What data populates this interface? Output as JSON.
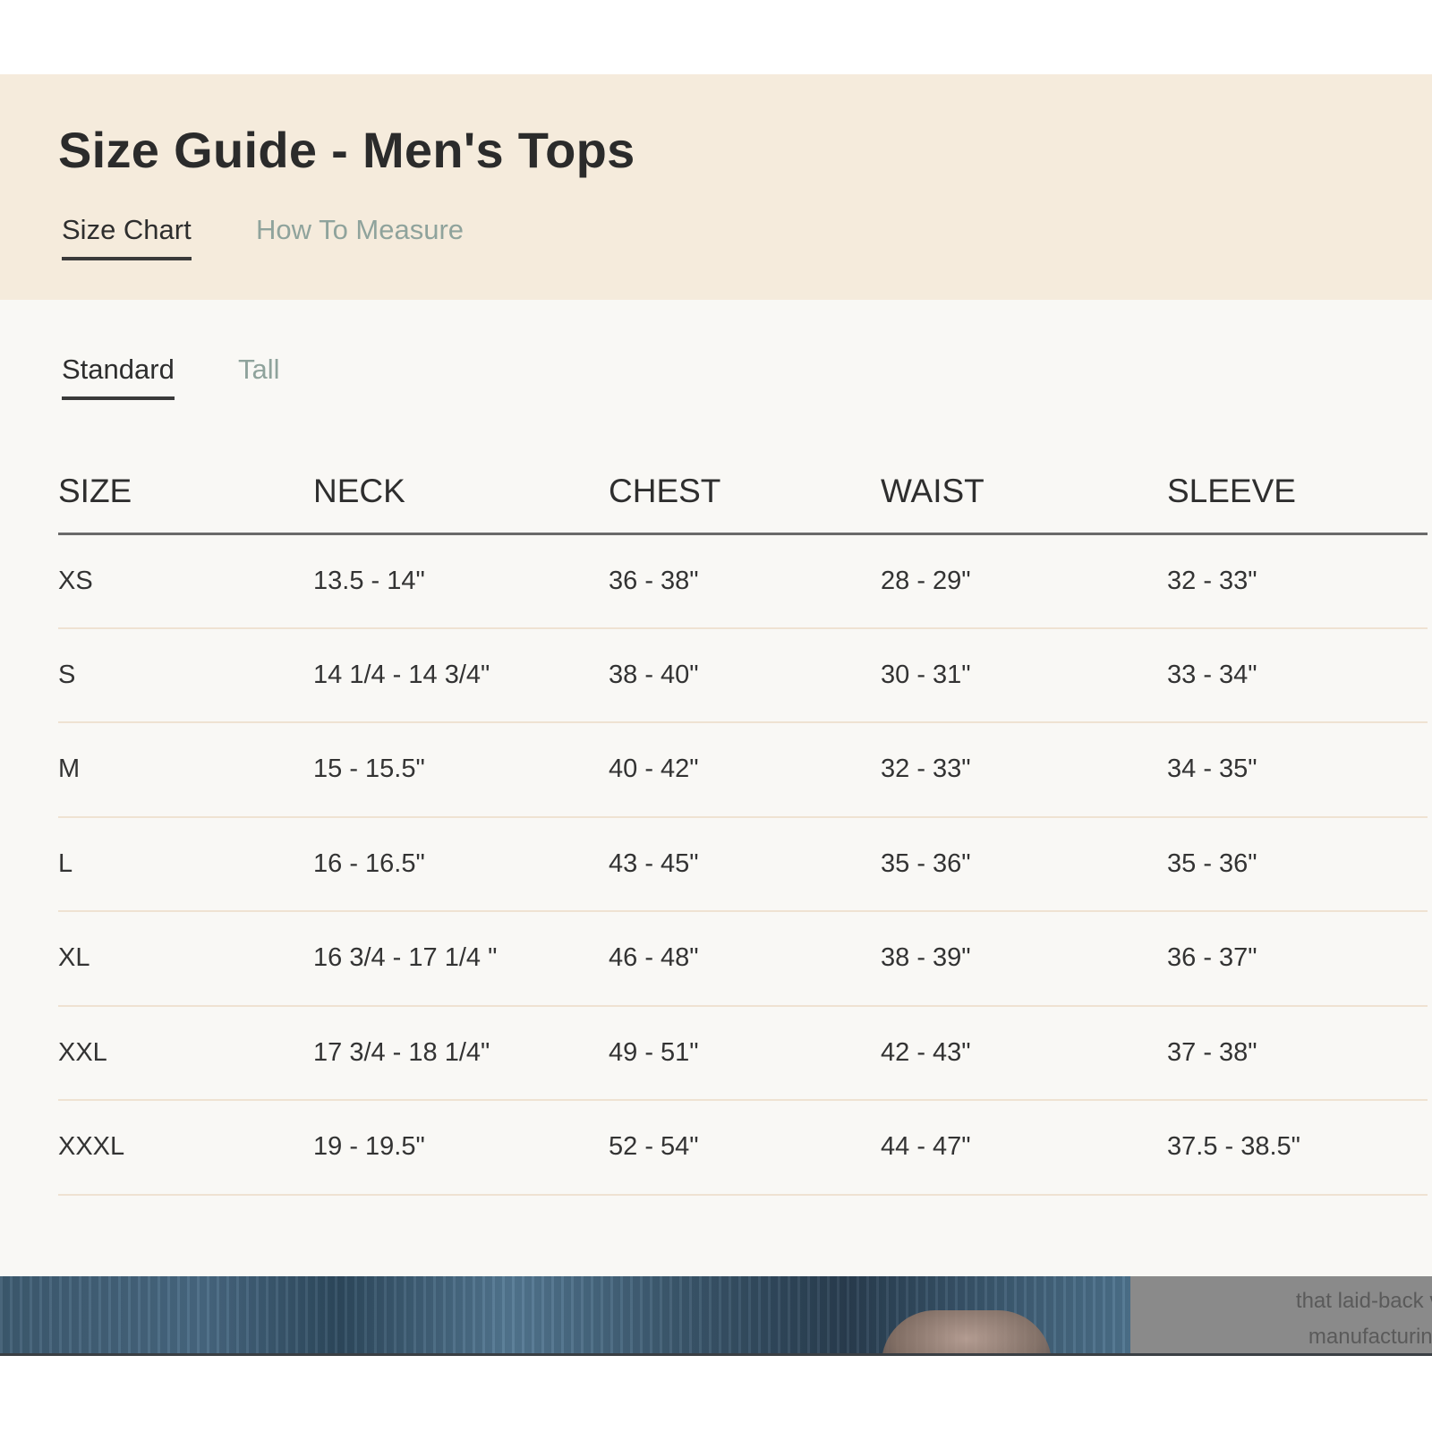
{
  "header": {
    "title": "Size Guide - Men's Tops",
    "tabs": [
      {
        "label": "Size Chart",
        "active": true
      },
      {
        "label": "How To Measure",
        "active": false
      }
    ]
  },
  "fit_tabs": [
    {
      "label": "Standard",
      "active": true
    },
    {
      "label": "Tall",
      "active": false
    }
  ],
  "table": {
    "headers": [
      "SIZE",
      "NECK",
      "CHEST",
      "WAIST",
      "SLEEVE"
    ],
    "rows": [
      [
        "XS",
        "13.5 - 14\"",
        "36 - 38\"",
        "28 - 29\"",
        "32 - 33\""
      ],
      [
        "S",
        "14 1/4 - 14 3/4\"",
        "38 - 40\"",
        "30 - 31\"",
        "33 - 34\""
      ],
      [
        "M",
        "15 - 15.5\"",
        "40 - 42\"",
        "32 - 33\"",
        "34 - 35\""
      ],
      [
        "L",
        "16 - 16.5\"",
        "43 - 45\"",
        "35 - 36\"",
        "35 - 36\""
      ],
      [
        "XL",
        "16 3/4 - 17 1/4 \"",
        "46 - 48\"",
        "38 - 39\"",
        "36 - 37\""
      ],
      [
        "XXL",
        "17 3/4 - 18 1/4\"",
        "49 - 51\"",
        "42 - 43\"",
        "37 - 38\""
      ],
      [
        "XXXL",
        "19 - 19.5\"",
        "52 - 54\"",
        "44 - 47\"",
        "37.5 - 38.5\""
      ]
    ]
  },
  "background_page": {
    "text_lines": [
      "that laid-back vib",
      "manufacturing i"
    ]
  },
  "colors": {
    "header_bg": "#f5ebdc",
    "body_bg": "#f9f8f5",
    "inactive_tab": "#8fa39c",
    "row_divider": "#efe2d2"
  }
}
